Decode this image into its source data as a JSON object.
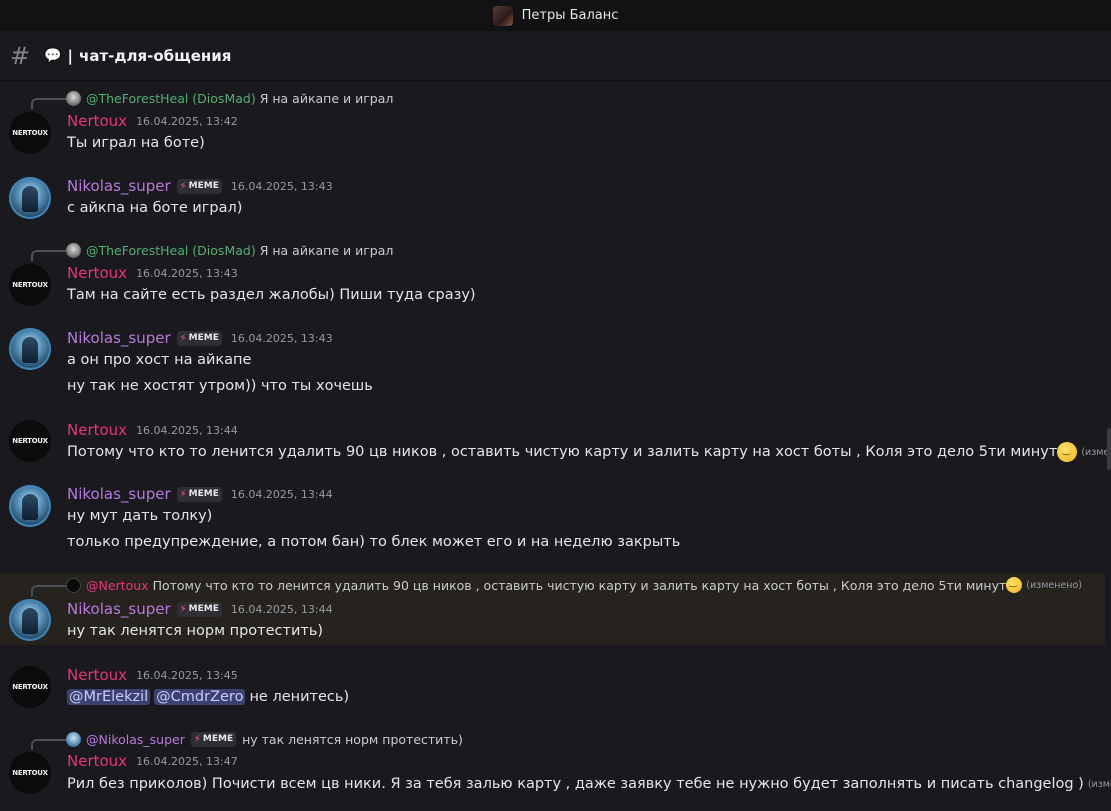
{
  "window": {
    "title": "Петры Баланс"
  },
  "channel": {
    "hash": "#",
    "name": "чат-для-общения",
    "separator": "|"
  },
  "users": {
    "nertoux": {
      "name": "Nertoux",
      "avatar_text": "NERTOUX",
      "color": "#e7357a"
    },
    "nikolas": {
      "name": "Nikolas_super",
      "tag": "MEME",
      "color": "#b57bdc"
    },
    "forest": {
      "name": "@TheForestHeal (DiosMad)",
      "color": "#4fae74"
    }
  },
  "messages": [
    {
      "reply": {
        "author": "@TheForestHeal (DiosMad)",
        "text": "Я на айкапе и играл"
      },
      "author": "Nertoux",
      "time": "16.04.2025, 13:42",
      "lines": [
        "Ты играл на боте)"
      ]
    },
    {
      "author": "Nikolas_super",
      "tag": "MEME",
      "time": "16.04.2025, 13:43",
      "lines": [
        "с айкпа на боте играл)"
      ]
    },
    {
      "reply": {
        "author": "@TheForestHeal (DiosMad)",
        "text": "Я на айкапе и играл"
      },
      "author": "Nertoux",
      "time": "16.04.2025, 13:43",
      "lines": [
        "Там на сайте есть раздел жалобы) Пиши туда сразу)"
      ]
    },
    {
      "author": "Nikolas_super",
      "tag": "MEME",
      "time": "16.04.2025, 13:43",
      "lines": [
        "а он про хост на айкапе",
        "ну так не хостят утром)) что ты хочешь"
      ]
    },
    {
      "author": "Nertoux",
      "time": "16.04.2025, 13:44",
      "lines": [
        "Потому что кто то ленится удалить 90 цв ников , оставить чистую карту и залить  карту на хост боты  , Коля это дело 5ти минут"
      ],
      "edited": "(изменено)"
    },
    {
      "author": "Nikolas_super",
      "tag": "MEME",
      "time": "16.04.2025, 13:44",
      "lines": [
        "ну мут дать толку)",
        "только предупреждение, а потом бан) то блек может его и на неделю закрыть"
      ]
    },
    {
      "reply": {
        "author": "@Nertoux",
        "text": "Потому что кто то ленится удалить 90 цв ников , оставить чистую карту и залить  карту на хост боты  , Коля это дело 5ти минут",
        "edited": "(изменено)"
      },
      "author": "Nikolas_super",
      "tag": "MEME",
      "time": "16.04.2025, 13:44",
      "lines": [
        "ну так ленятся норм протестить)"
      ]
    },
    {
      "author": "Nertoux",
      "time": "16.04.2025, 13:45",
      "mentions": [
        "@MrElekzil",
        "@CmdrZero"
      ],
      "lines": [
        "не ленитесь)"
      ]
    },
    {
      "reply": {
        "author": "@Nikolas_super",
        "tag": "MEME",
        "text": "ну так ленятся норм протестить)"
      },
      "author": "Nertoux",
      "time": "16.04.2025, 13:47",
      "lines": [
        "Рил без приколов) Почисти всем цв ники. Я за тебя залью карту , даже заявку тебе не нужно будет заполнять и писать changelog )"
      ],
      "edited": "(изменено)"
    }
  ]
}
